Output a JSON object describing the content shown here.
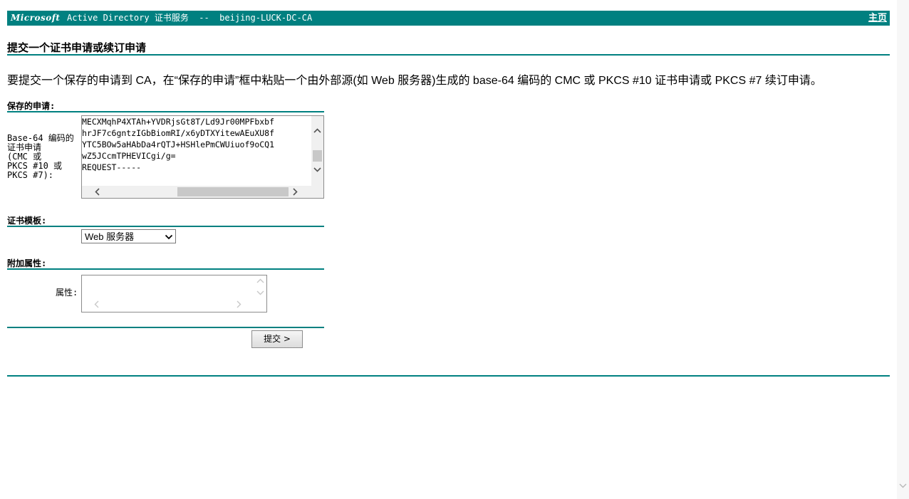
{
  "header": {
    "brand": "Microsoft",
    "title": "Active Directory 证书服务  --  beijing-LUCK-DC-CA",
    "home_link": "主页"
  },
  "page_title": "提交一个证书申请或续订申请",
  "description": "要提交一个保存的申请到 CA，在“保存的申请”框中粘贴一个由外部源(如 Web 服务器)生成的 base-64 编码的 CMC 或 PKCS #10 证书申请或 PKCS #7 续订申请。",
  "saved_request": {
    "section_label": "保存的申请:",
    "field_label_lines": [
      "Base-64 编码的",
      "证书申请",
      "(CMC 或",
      "PKCS #10 或",
      "PKCS #7):"
    ],
    "content_lines": [
      "MECXMqhP4XTAh+YVDRjsGt8T/Ld9Jr00MPFbxbf",
      "hrJF7c6gntzIGbBiomRI/x6yDTXYitewAEuXU8f",
      "YTC5BOw5aHAbDa4rQTJ+HSHlePmCWUiuof9oCQ1",
      "wZ5JCcmTPHEVICgi/g=",
      "REQUEST-----"
    ]
  },
  "template": {
    "section_label": "证书模板:",
    "selected": "Web 服务器"
  },
  "additional_attributes": {
    "section_label": "附加属性:",
    "field_label": "属性:",
    "value": ""
  },
  "submit_label": "提交 >",
  "icons": {
    "scroll_up": "chevron-up-icon",
    "scroll_down": "chevron-down-icon",
    "scroll_left": "chevron-left-icon",
    "scroll_right": "chevron-right-icon",
    "dropdown": "chevron-down-icon"
  },
  "colors": {
    "accent": "#008080"
  }
}
